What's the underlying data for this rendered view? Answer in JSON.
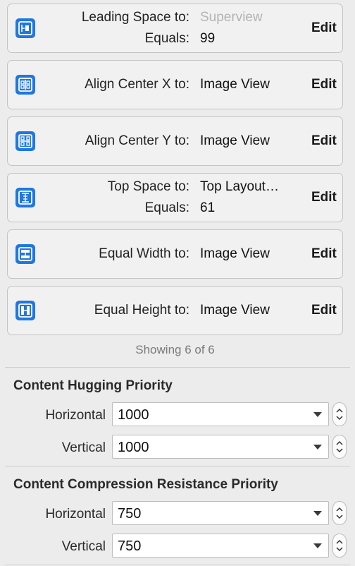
{
  "constraints": [
    {
      "label": "Leading Space to:",
      "value": "Superview",
      "value_dimmed": true,
      "label2": "Equals:",
      "value2": "99",
      "edit": "Edit",
      "icon": "leading-space-icon"
    },
    {
      "label": "Align Center X to:",
      "value": "Image View",
      "edit": "Edit",
      "icon": "align-center-x-icon"
    },
    {
      "label": "Align Center Y to:",
      "value": "Image View",
      "edit": "Edit",
      "icon": "align-center-y-icon"
    },
    {
      "label": "Top Space to:",
      "value": "Top Layout…",
      "label2": "Equals:",
      "value2": "61",
      "edit": "Edit",
      "icon": "top-space-icon"
    },
    {
      "label": "Equal Width to:",
      "value": "Image View",
      "edit": "Edit",
      "icon": "equal-width-icon"
    },
    {
      "label": "Equal Height to:",
      "value": "Image View",
      "edit": "Edit",
      "icon": "equal-height-icon"
    }
  ],
  "showing": "Showing 6 of 6",
  "hugging": {
    "title": "Content Hugging Priority",
    "horizontal_label": "Horizontal",
    "horizontal_value": "1000",
    "vertical_label": "Vertical",
    "vertical_value": "1000"
  },
  "compression": {
    "title": "Content Compression Resistance Priority",
    "horizontal_label": "Horizontal",
    "horizontal_value": "750",
    "vertical_label": "Vertical",
    "vertical_value": "750"
  },
  "colors": {
    "icon_blue": "#1f78e0",
    "dim_text": "#b3b3b3"
  }
}
